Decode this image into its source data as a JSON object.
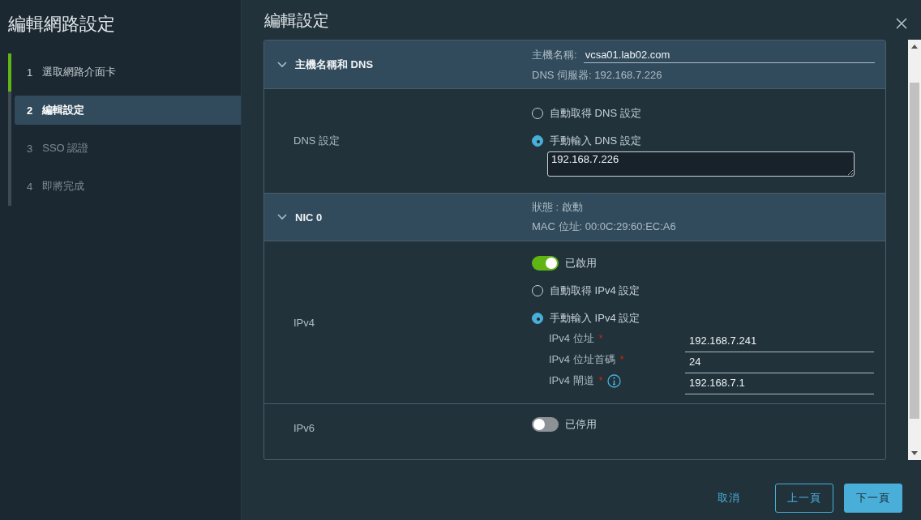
{
  "sidebar": {
    "title": "編輯網路設定",
    "steps": [
      {
        "number": "1",
        "label": "選取網路介面卡",
        "completed": true,
        "selected": false
      },
      {
        "number": "2",
        "label": "編輯設定",
        "completed": false,
        "selected": true
      },
      {
        "number": "3",
        "label": "SSO 認證",
        "completed": false,
        "selected": false
      },
      {
        "number": "4",
        "label": "即將完成",
        "completed": false,
        "selected": false
      }
    ]
  },
  "main": {
    "title": "編輯設定",
    "sections": [
      {
        "title": "主機名稱和 DNS",
        "expanded": true,
        "info": [
          {
            "kind": "field",
            "label": "主機名稱:",
            "value": "vcsa01.lab02.com"
          },
          {
            "kind": "text",
            "text": "DNS 伺服器: 192.168.7.226"
          }
        ],
        "rows": [
          {
            "label": "DNS 設定",
            "controls": [
              {
                "kind": "radio",
                "label": "自動取得 DNS 設定",
                "selected": false
              },
              {
                "kind": "radio",
                "label": "手動輸入 DNS 設定",
                "selected": true
              },
              {
                "kind": "textarea",
                "value": "192.168.7.226"
              }
            ]
          }
        ]
      },
      {
        "title": "NIC 0",
        "expanded": true,
        "info": [
          {
            "kind": "text",
            "text": "狀態 : 啟動"
          },
          {
            "kind": "text",
            "text": "MAC 位址: 00:0C:29:60:EC:A6"
          }
        ],
        "rows": [
          {
            "label": "IPv4",
            "controls": [
              {
                "kind": "toggle",
                "label": "已啟用",
                "on": true
              },
              {
                "kind": "radio",
                "label": "自動取得 IPv4 設定",
                "selected": false
              },
              {
                "kind": "radio",
                "label": "手動輸入 IPv4 設定",
                "selected": true
              },
              {
                "kind": "field",
                "label": "IPv4 位址",
                "required_mark": "*",
                "info": false,
                "value": "192.168.7.241"
              },
              {
                "kind": "field",
                "label": "IPv4 位址首碼",
                "required_mark": "*",
                "info": false,
                "value": "24"
              },
              {
                "kind": "field",
                "label": "IPv4 閘道",
                "required_mark": "*",
                "info": true,
                "value": "192.168.7.1"
              }
            ]
          },
          {
            "label": "IPv6",
            "controls": [
              {
                "kind": "toggle",
                "label": "已停用",
                "on": false
              }
            ]
          }
        ]
      }
    ]
  },
  "buttons": [
    {
      "kind": "link",
      "label": "取消"
    },
    {
      "kind": "outline",
      "label": "上一頁"
    },
    {
      "kind": "primary",
      "label": "下一頁"
    }
  ]
}
